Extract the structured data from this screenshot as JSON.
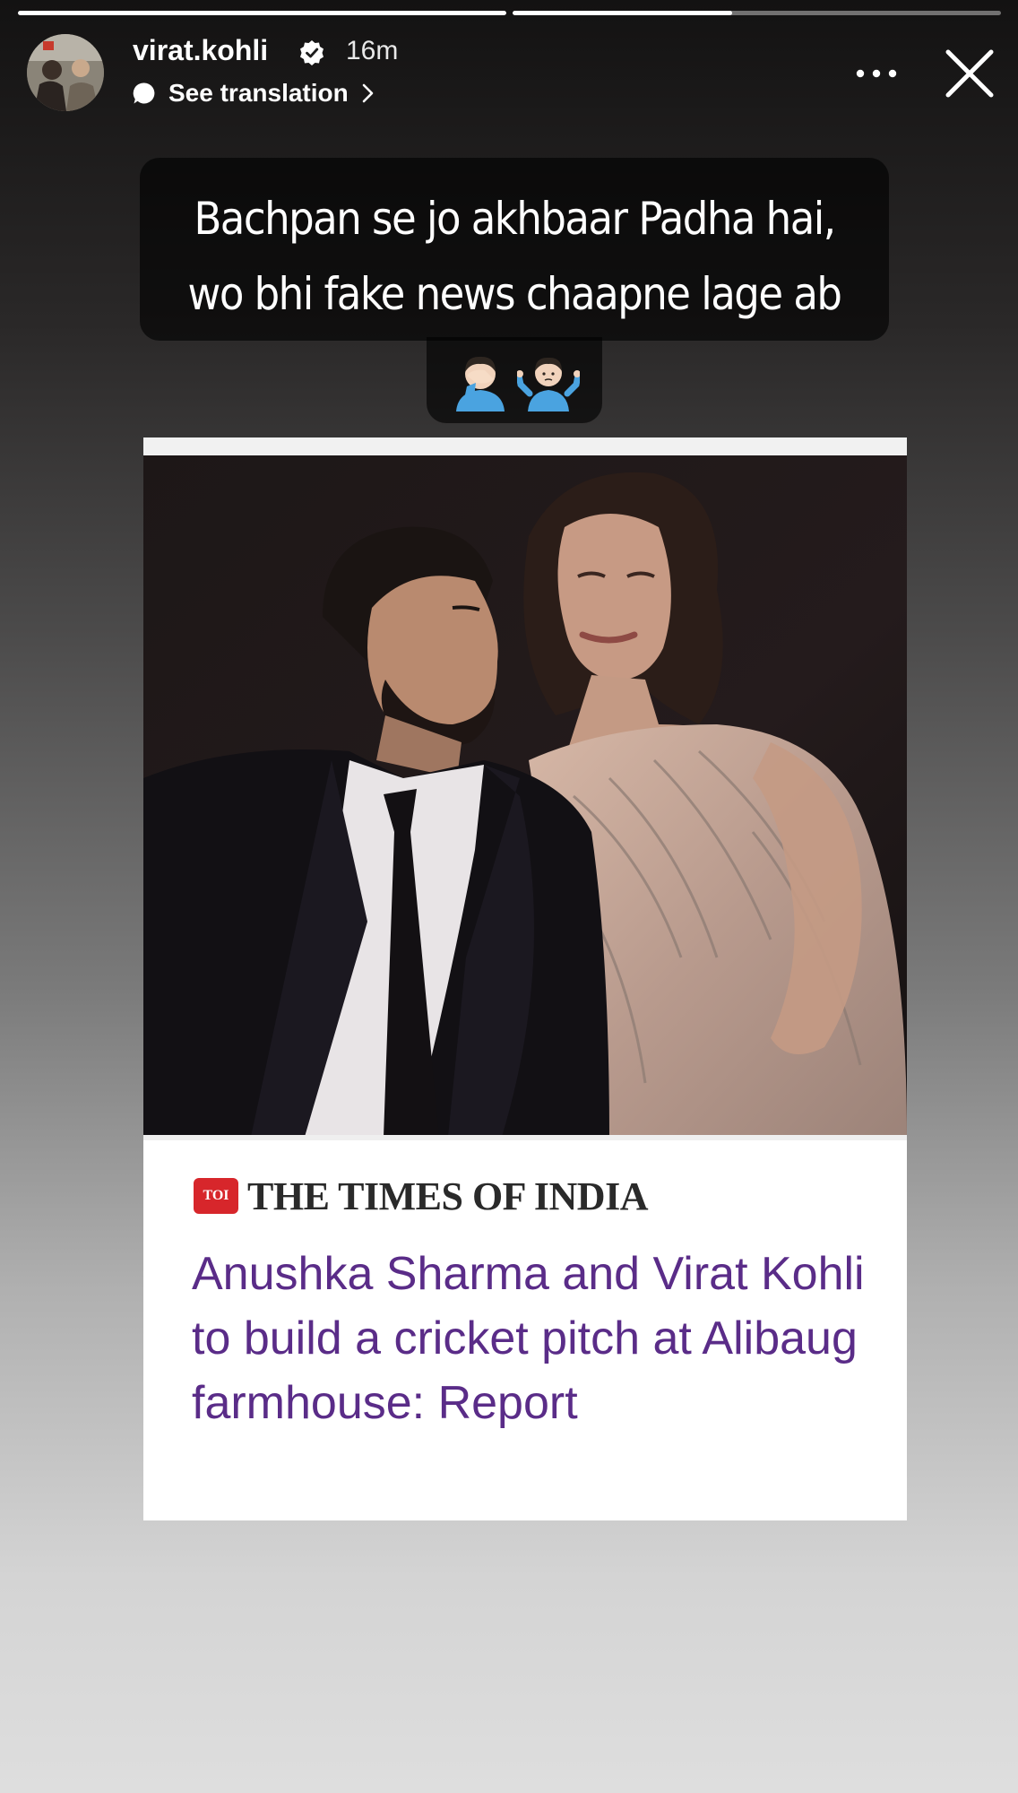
{
  "story": {
    "progress": [
      1.0,
      0.45
    ],
    "author": {
      "username": "virat.kohli",
      "verified": true,
      "time_ago": "16m"
    },
    "translate_label": "See translation",
    "caption_lines": [
      "Bachpan se jo akhbaar Padha hai,",
      "wo bhi fake news chaapne lage ab"
    ],
    "emojis": [
      "man-facepalming-emoji",
      "man-shrugging-emoji"
    ]
  },
  "news_card": {
    "publisher_logo": "TOI",
    "publisher": "THE TIMES OF INDIA",
    "headline": "Anushka Sharma and Virat Kohli to build a cricket pitch at Alibaug farmhouse: Report"
  },
  "colors": {
    "headline": "#5a2c88",
    "logo_red": "#d7262b",
    "overlay": "rgba(0,0,0,0.62)"
  }
}
